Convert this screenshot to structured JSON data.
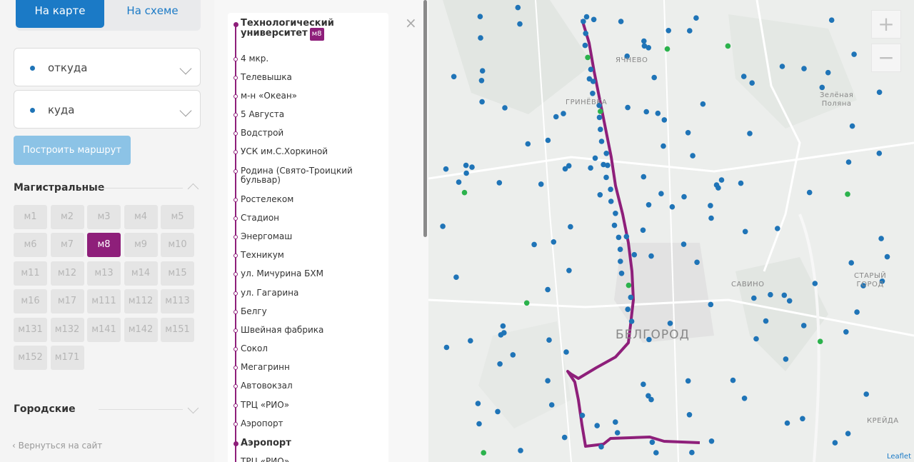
{
  "colors": {
    "accent": "#1b7ac6",
    "route": "#8e1f7a",
    "stop_blue": "#1f74b7",
    "stop_green": "#2bb24c"
  },
  "mode_tabs": {
    "map": "На карте",
    "scheme": "На схеме"
  },
  "from": {
    "placeholder": "откуда"
  },
  "to": {
    "placeholder": "куда"
  },
  "build_route": "Построить маршрут",
  "sections": {
    "main": "Магистральные",
    "city": "Городские"
  },
  "routes": [
    "м1",
    "м2",
    "м3",
    "м4",
    "м5",
    "м6",
    "м7",
    "м8",
    "м9",
    "м10",
    "м11",
    "м12",
    "м13",
    "м14",
    "м15",
    "м16",
    "м17",
    "м111",
    "м112",
    "м113",
    "м131",
    "м132",
    "м141",
    "м142",
    "м151",
    "м152",
    "м171"
  ],
  "active_route": "м8",
  "back_link": "‹ Вернуться на сайт",
  "stops_panel": {
    "first_stop": "Технологический университет",
    "badge": "м8",
    "stops": [
      "4 мкр.",
      "Телевышка",
      "м-н «Океан»",
      "5 Августа",
      "Водстрой",
      "УСК им.С.Хоркиной",
      "Родина (Свято-Троицкий бульвар)",
      "Ростелеком",
      "Стадион",
      "Энергомаш",
      "Техникум",
      "ул. Мичурина БХМ",
      "ул. Гагарина",
      "Белгу",
      "Швейная фабрика",
      "Сокол",
      "Мегагринн",
      "Автовокзал",
      "ТРЦ «РИО»",
      "Аэропорт"
    ],
    "terminal_stop": "Аэропорт",
    "after_terminal": "ТРЦ «РИО»",
    "close": "×"
  },
  "map": {
    "zoom_in": "+",
    "zoom_out": "−",
    "labels": {
      "yachnevo": "ЯЧНЕВО",
      "grinevka": "ГРИНЁВКА",
      "zelenaya_polyana": "Зелёная\nПоляна",
      "savino": "САВИНО",
      "stary_gorod": "СТАРЫЙ\nГОРОД",
      "belgorod": "БЕЛГОРОД",
      "kreida": "КРЕЙДА"
    },
    "attribution": "Leaflet"
  }
}
